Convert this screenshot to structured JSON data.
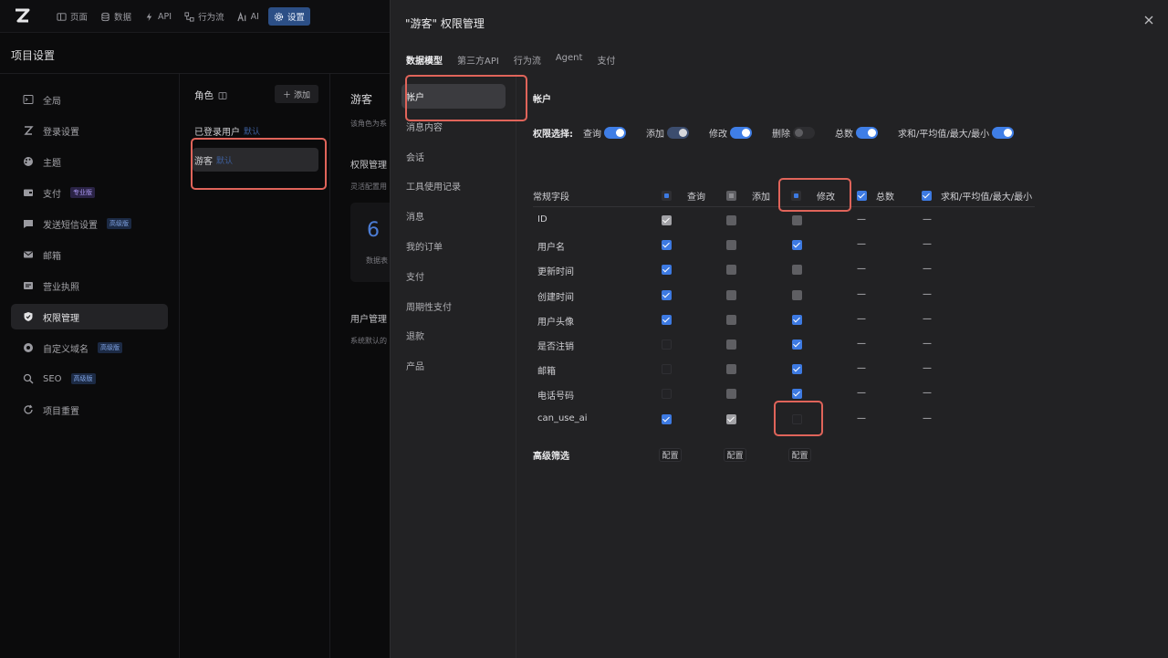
{
  "topnav": {
    "items": [
      {
        "label": "页面",
        "icon": "page-icon"
      },
      {
        "label": "数据",
        "icon": "database-icon"
      },
      {
        "label": "API",
        "icon": "api-icon"
      },
      {
        "label": "行为流",
        "icon": "flow-icon"
      },
      {
        "label": "AI",
        "icon": "ai-icon"
      },
      {
        "label": "设置",
        "icon": "gear-icon",
        "active": true
      }
    ]
  },
  "page": {
    "title": "项目设置"
  },
  "menu": [
    {
      "label": "全局",
      "icon": "terminal-icon"
    },
    {
      "label": "登录设置",
      "icon": "login-icon"
    },
    {
      "label": "主题",
      "icon": "palette-icon"
    },
    {
      "label": "支付",
      "icon": "wallet-icon",
      "badge": "专业版"
    },
    {
      "label": "发送短信设置",
      "icon": "message-icon",
      "badge": "高级版"
    },
    {
      "label": "邮箱",
      "icon": "mail-icon"
    },
    {
      "label": "营业执照",
      "icon": "license-icon"
    },
    {
      "label": "权限管理",
      "icon": "shield-icon",
      "active": true
    },
    {
      "label": "自定义域名",
      "icon": "domain-icon",
      "badge": "高级版"
    },
    {
      "label": "SEO",
      "icon": "search-icon",
      "badge": "高级版"
    },
    {
      "label": "项目重置",
      "icon": "reset-icon"
    }
  ],
  "roles": {
    "heading": "角色",
    "add_label": "添加",
    "items": [
      {
        "name": "已登录用户",
        "tag": "默认"
      },
      {
        "name": "游客",
        "tag": "默认"
      }
    ]
  },
  "behind": {
    "title": "游客",
    "desc": "该角色为系",
    "perm_title": "权限管理",
    "perm_desc": "灵活配置用",
    "stat_value": "6",
    "stat_label": "数据表",
    "user_title": "用户管理",
    "user_desc": "系统默认的"
  },
  "modal": {
    "title": "\"游客\" 权限管理",
    "tabs": [
      "数据模型",
      "第三方API",
      "行为流",
      "Agent",
      "支付"
    ],
    "tables": [
      "帐户",
      "消息内容",
      "会话",
      "工具使用记录",
      "消息",
      "我的订单",
      "支付",
      "周期性支付",
      "退款",
      "产品"
    ],
    "section_title": "帐户",
    "perm_label": "权限选择:",
    "perms": [
      {
        "label": "查询",
        "state": "on"
      },
      {
        "label": "添加",
        "state": "mid"
      },
      {
        "label": "修改",
        "state": "on"
      },
      {
        "label": "删除",
        "state": "off"
      },
      {
        "label": "总数",
        "state": "on"
      },
      {
        "label": "求和/平均值/最大/最小",
        "state": "on"
      }
    ],
    "field_header": "常规字段",
    "col_headers": [
      "查询",
      "添加",
      "修改",
      "总数",
      "求和/平均值/最大/最小"
    ],
    "rows": [
      {
        "name": "ID",
        "query": "grey-checked",
        "add": "grey",
        "edit": "grey"
      },
      {
        "name": "用户名",
        "query": "checked",
        "add": "grey",
        "edit": "checked"
      },
      {
        "name": "更新时间",
        "query": "checked",
        "add": "grey",
        "edit": "grey"
      },
      {
        "name": "创建时间",
        "query": "checked",
        "add": "grey",
        "edit": "grey"
      },
      {
        "name": "用户头像",
        "query": "checked",
        "add": "grey",
        "edit": "checked"
      },
      {
        "name": "是否注销",
        "query": "empty",
        "add": "grey",
        "edit": "checked"
      },
      {
        "name": "邮箱",
        "query": "empty",
        "add": "grey",
        "edit": "checked"
      },
      {
        "name": "电话号码",
        "query": "empty",
        "add": "grey",
        "edit": "checked"
      },
      {
        "name": "can_use_ai",
        "query": "checked",
        "add": "grey-checked",
        "edit": "empty"
      }
    ],
    "dash": "—",
    "advanced_label": "高级筛选",
    "config_label": "配置"
  }
}
